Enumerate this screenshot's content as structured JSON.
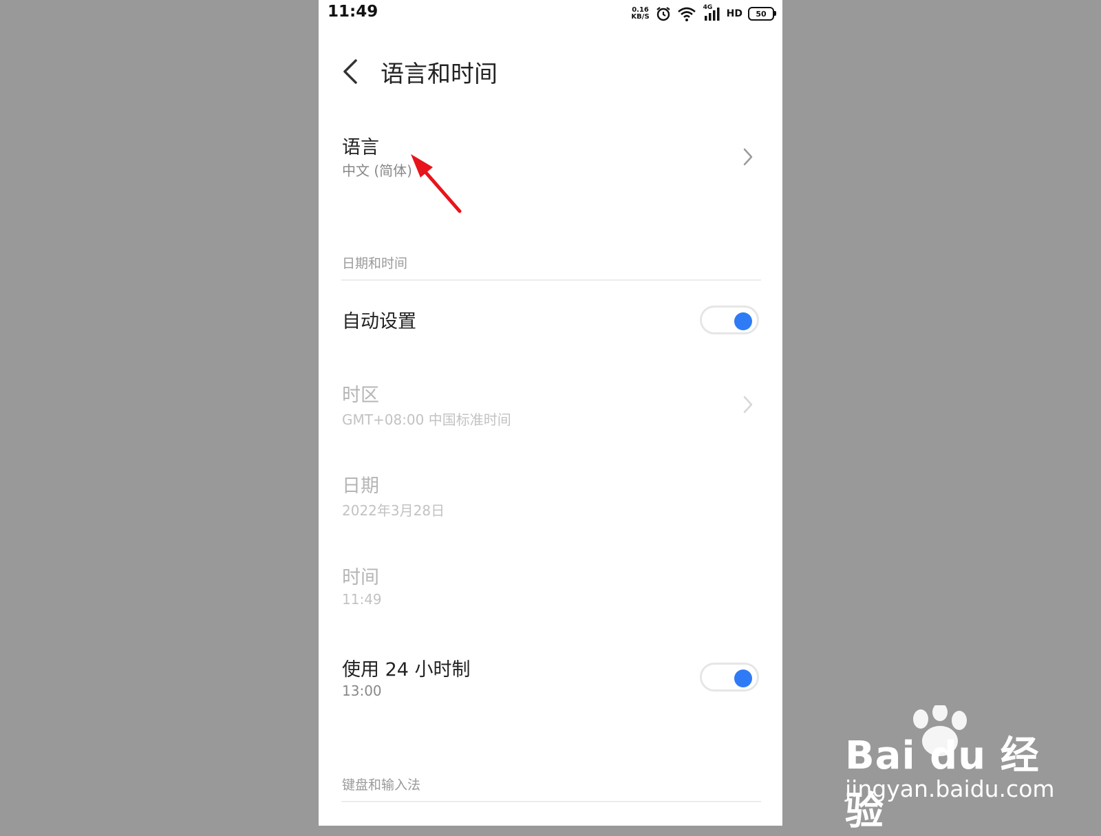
{
  "status_bar": {
    "time": "11:49",
    "net_speed_value": "0.16",
    "net_speed_unit": "KB/S",
    "network_type": "4G",
    "hd_label": "HD",
    "battery_level": "50",
    "icons": [
      "alarm-icon",
      "wifi-icon",
      "signal-icon",
      "battery-icon"
    ]
  },
  "header": {
    "back_icon": "chevron-left-icon",
    "title": "语言和时间"
  },
  "language_row": {
    "title": "语言",
    "value": "中文 (简体)"
  },
  "date_time_section": {
    "label": "日期和时间"
  },
  "auto_set_row": {
    "title": "自动设置",
    "toggle_on": true
  },
  "timezone_row": {
    "title": "时区",
    "value": "GMT+08:00 中国标准时间",
    "enabled": false
  },
  "date_row": {
    "title": "日期",
    "value": "2022年3月28日",
    "enabled": false
  },
  "time_row": {
    "title": "时间",
    "value": "11:49",
    "enabled": false
  },
  "hour24_row": {
    "title": "使用 24 小时制",
    "value": "13:00",
    "toggle_on": true
  },
  "keyboard_section": {
    "label": "键盘和输入法"
  },
  "colors": {
    "accent": "#2f7bf5",
    "annotation_arrow": "#e8141b",
    "background_outer": "#999999"
  },
  "watermark": {
    "brand": "Bai du 经验",
    "url": "jingyan.baidu.com"
  }
}
